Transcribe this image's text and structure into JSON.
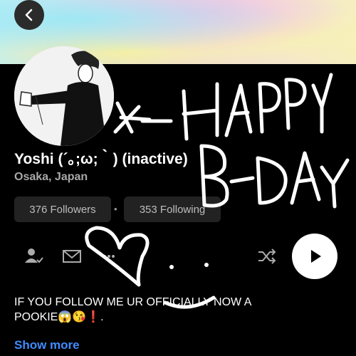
{
  "profile": {
    "name": "Yoshi (´｡;ω;｀) (inactive)",
    "location": "Osaka, Japan",
    "followers_label": "376 Followers",
    "separator": "•",
    "following_label": "353 Following",
    "bio_line1": "IF YOU FOLLOW ME UR OFFICIALLY NOW A",
    "bio_line2": "POOKIE😱😘❗.",
    "show_more_label": "Show more"
  },
  "icons": {
    "back": "back-arrow-icon",
    "follow": "person-check-icon",
    "message": "mail-icon",
    "more": "more-dots-icon",
    "shuffle": "shuffle-icon",
    "play": "play-icon"
  },
  "colors": {
    "background": "#000000",
    "link": "#3f8cff",
    "pill_bg": "#222222",
    "secondary_text": "#a9a9a9"
  }
}
